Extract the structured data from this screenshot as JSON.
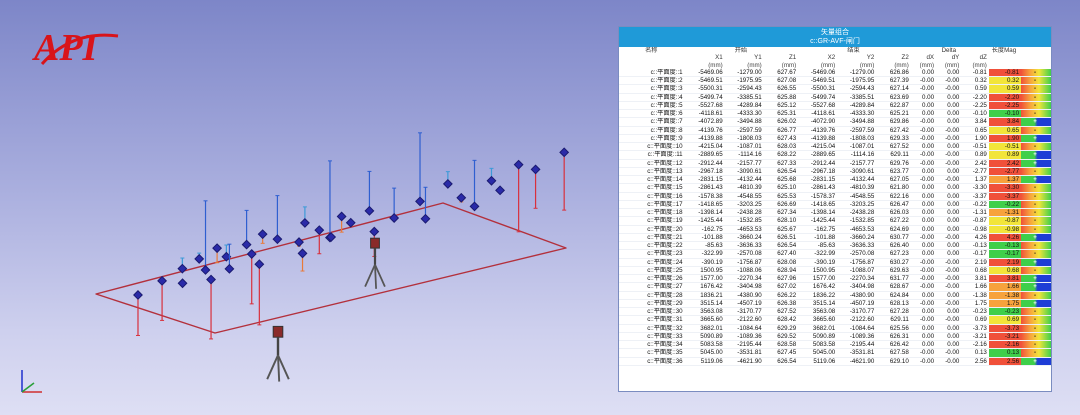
{
  "logo": {
    "text": "API"
  },
  "panel": {
    "title": "矢量组合",
    "subtitle": "c::GR-AVF-闸门",
    "group_headers": {
      "name": "名称",
      "start": "开始",
      "end": "结束",
      "delta": "Delta",
      "mag": "长度Mag"
    },
    "columns": [
      "X1",
      "Y1",
      "Z1",
      "X2",
      "Y2",
      "Z2",
      "dX",
      "dY",
      "dZ"
    ],
    "units": [
      "(mm)",
      "(mm)",
      "(mm)",
      "(mm)",
      "(mm)",
      "(mm)",
      "(mm)",
      "(mm)",
      "(mm)"
    ]
  },
  "colors": {
    "title_bar": "#1f9ad8",
    "red": "#f0503a",
    "orange": "#f7a23c",
    "yellow": "#f2e53a",
    "green": "#3fcf4a",
    "blue": "#1e3dd6",
    "tolerance_bar": [
      "#3fcf4a",
      "#f2e53a",
      "#f7a23c",
      "#f0503a",
      "#1e3dd6"
    ]
  },
  "rows": [
    {
      "name": "c::平面度::1",
      "x1": "-5469.06",
      "y1": "-1279.00",
      "z1": "627.67",
      "x2": "-5469.06",
      "y2": "-1279.00",
      "z2": "626.86",
      "dx": "0.00",
      "dy": "0.00",
      "dz": "-0.81",
      "mag": "-0.81",
      "ind": "-",
      "band": "red"
    },
    {
      "name": "c::平面度::2",
      "x1": "-5469.51",
      "y1": "-1975.95",
      "z1": "627.08",
      "x2": "-5469.51",
      "y2": "-1975.95",
      "z2": "627.39",
      "dx": "-0.00",
      "dy": "-0.00",
      "dz": "0.32",
      "mag": "0.32",
      "ind": "-",
      "band": "yellow"
    },
    {
      "name": "c::平面度::3",
      "x1": "-5500.31",
      "y1": "-2594.43",
      "z1": "626.55",
      "x2": "-5500.31",
      "y2": "-2594.43",
      "z2": "627.14",
      "dx": "-0.00",
      "dy": "-0.00",
      "dz": "0.59",
      "mag": "0.59",
      "ind": "-",
      "band": "yellow"
    },
    {
      "name": "c::平面度::4",
      "x1": "-5499.74",
      "y1": "-3385.51",
      "z1": "625.88",
      "x2": "-5499.74",
      "y2": "-3385.51",
      "z2": "623.69",
      "dx": "0.00",
      "dy": "0.00",
      "dz": "-2.20",
      "mag": "-2.20",
      "ind": "-",
      "band": "red"
    },
    {
      "name": "c::平面度::5",
      "x1": "-5527.68",
      "y1": "-4289.84",
      "z1": "625.12",
      "x2": "-5527.68",
      "y2": "-4289.84",
      "z2": "622.87",
      "dx": "0.00",
      "dy": "0.00",
      "dz": "-2.25",
      "mag": "-2.25",
      "ind": "-",
      "band": "red"
    },
    {
      "name": "c::平面度::6",
      "x1": "-4118.61",
      "y1": "-4333.30",
      "z1": "625.31",
      "x2": "-4118.61",
      "y2": "-4333.30",
      "z2": "625.21",
      "dx": "0.00",
      "dy": "0.00",
      "dz": "-0.10",
      "mag": "-0.10",
      "ind": "-",
      "band": "green"
    },
    {
      "name": "c::平面度::7",
      "x1": "-4072.89",
      "y1": "-3494.88",
      "z1": "626.02",
      "x2": "-4072.90",
      "y2": "-3494.88",
      "z2": "629.86",
      "dx": "-0.00",
      "dy": "0.00",
      "dz": "3.84",
      "mag": "3.84",
      "ind": "+",
      "band": "red"
    },
    {
      "name": "c::平面度::8",
      "x1": "-4139.76",
      "y1": "-2597.59",
      "z1": "626.77",
      "x2": "-4139.76",
      "y2": "-2597.59",
      "z2": "627.42",
      "dx": "-0.00",
      "dy": "-0.00",
      "dz": "0.65",
      "mag": "0.65",
      "ind": "-",
      "band": "yellow"
    },
    {
      "name": "c::平面度::9",
      "x1": "-4139.88",
      "y1": "-1808.03",
      "z1": "627.43",
      "x2": "-4139.88",
      "y2": "-1808.03",
      "z2": "629.33",
      "dx": "-0.00",
      "dy": "-0.00",
      "dz": "1.90",
      "mag": "1.90",
      "ind": "+",
      "band": "red"
    },
    {
      "name": "c::平面度::10",
      "x1": "-4215.04",
      "y1": "-1087.01",
      "z1": "628.03",
      "x2": "-4215.04",
      "y2": "-1087.01",
      "z2": "627.52",
      "dx": "0.00",
      "dy": "0.00",
      "dz": "-0.51",
      "mag": "-0.51",
      "ind": "-",
      "band": "yellow"
    },
    {
      "name": "c::平面度::11",
      "x1": "-2889.65",
      "y1": "-1114.16",
      "z1": "628.22",
      "x2": "-2889.65",
      "y2": "-1114.16",
      "z2": "629.11",
      "dx": "-0.00",
      "dy": "-0.00",
      "dz": "0.89",
      "mag": "0.89",
      "ind": "+",
      "band": "yellow"
    },
    {
      "name": "c::平面度::12",
      "x1": "-2912.44",
      "y1": "-2157.77",
      "z1": "627.33",
      "x2": "-2912.44",
      "y2": "-2157.77",
      "z2": "629.76",
      "dx": "-0.00",
      "dy": "-0.00",
      "dz": "2.42",
      "mag": "2.42",
      "ind": "+",
      "band": "red"
    },
    {
      "name": "c::平面度::13",
      "x1": "-2967.18",
      "y1": "-3090.61",
      "z1": "626.54",
      "x2": "-2967.18",
      "y2": "-3090.61",
      "z2": "623.77",
      "dx": "0.00",
      "dy": "0.00",
      "dz": "-2.77",
      "mag": "-2.77",
      "ind": "-",
      "band": "red"
    },
    {
      "name": "c::平面度::14",
      "x1": "-2831.15",
      "y1": "-4132.44",
      "z1": "625.68",
      "x2": "-2831.15",
      "y2": "-4132.44",
      "z2": "627.05",
      "dx": "-0.00",
      "dy": "-0.00",
      "dz": "1.37",
      "mag": "1.37",
      "ind": "+",
      "band": "orange"
    },
    {
      "name": "c::平面度::15",
      "x1": "-2861.43",
      "y1": "-4810.39",
      "z1": "625.10",
      "x2": "-2861.43",
      "y2": "-4810.39",
      "z2": "621.80",
      "dx": "0.00",
      "dy": "0.00",
      "dz": "-3.30",
      "mag": "-3.30",
      "ind": "-",
      "band": "red"
    },
    {
      "name": "c::平面度::16",
      "x1": "-1578.38",
      "y1": "-4548.55",
      "z1": "625.53",
      "x2": "-1578.37",
      "y2": "-4548.55",
      "z2": "622.16",
      "dx": "0.00",
      "dy": "0.00",
      "dz": "-3.37",
      "mag": "-3.37",
      "ind": "-",
      "band": "red"
    },
    {
      "name": "c::平面度::17",
      "x1": "-1418.65",
      "y1": "-3203.25",
      "z1": "626.69",
      "x2": "-1418.65",
      "y2": "-3203.25",
      "z2": "626.47",
      "dx": "0.00",
      "dy": "0.00",
      "dz": "-0.22",
      "mag": "-0.22",
      "ind": "-",
      "band": "green"
    },
    {
      "name": "c::平面度::18",
      "x1": "-1398.14",
      "y1": "-2438.28",
      "z1": "627.34",
      "x2": "-1398.14",
      "y2": "-2438.28",
      "z2": "626.03",
      "dx": "0.00",
      "dy": "0.00",
      "dz": "-1.31",
      "mag": "-1.31",
      "ind": "-",
      "band": "orange"
    },
    {
      "name": "c::平面度::19",
      "x1": "-1425.44",
      "y1": "-1532.85",
      "z1": "628.10",
      "x2": "-1425.44",
      "y2": "-1532.85",
      "z2": "627.22",
      "dx": "0.00",
      "dy": "0.00",
      "dz": "-0.87",
      "mag": "-0.87",
      "ind": "-",
      "band": "yellow"
    },
    {
      "name": "c::平面度::20",
      "x1": "-162.75",
      "y1": "-4653.53",
      "z1": "625.67",
      "x2": "-162.75",
      "y2": "-4653.53",
      "z2": "624.69",
      "dx": "0.00",
      "dy": "0.00",
      "dz": "-0.98",
      "mag": "-0.98",
      "ind": "-",
      "band": "yellow"
    },
    {
      "name": "c::平面度::21",
      "x1": "-101.88",
      "y1": "-3660.24",
      "z1": "626.51",
      "x2": "-101.88",
      "y2": "-3660.24",
      "z2": "630.77",
      "dx": "-0.00",
      "dy": "-0.00",
      "dz": "4.26",
      "mag": "4.26",
      "ind": "+",
      "band": "red"
    },
    {
      "name": "c::平面度::22",
      "x1": "-85.63",
      "y1": "-3636.33",
      "z1": "626.54",
      "x2": "-85.63",
      "y2": "-3636.33",
      "z2": "626.40",
      "dx": "0.00",
      "dy": "0.00",
      "dz": "-0.13",
      "mag": "-0.13",
      "ind": "-",
      "band": "green"
    },
    {
      "name": "c::平面度::23",
      "x1": "-322.99",
      "y1": "-2570.08",
      "z1": "627.40",
      "x2": "-322.99",
      "y2": "-2570.08",
      "z2": "627.23",
      "dx": "0.00",
      "dy": "0.00",
      "dz": "-0.17",
      "mag": "-0.17",
      "ind": "-",
      "band": "green"
    },
    {
      "name": "c::平面度::24",
      "x1": "-390.19",
      "y1": "-1756.87",
      "z1": "628.08",
      "x2": "-390.19",
      "y2": "-1756.87",
      "z2": "630.27",
      "dx": "-0.00",
      "dy": "-0.00",
      "dz": "2.19",
      "mag": "2.19",
      "ind": "+",
      "band": "red"
    },
    {
      "name": "c::平面度::25",
      "x1": "1500.95",
      "y1": "-1088.06",
      "z1": "628.94",
      "x2": "1500.95",
      "y2": "-1088.07",
      "z2": "629.63",
      "dx": "-0.00",
      "dy": "-0.00",
      "dz": "0.68",
      "mag": "0.68",
      "ind": "-",
      "band": "yellow"
    },
    {
      "name": "c::平面度::26",
      "x1": "1577.00",
      "y1": "-2270.34",
      "z1": "627.96",
      "x2": "1577.00",
      "y2": "-2270.34",
      "z2": "631.77",
      "dx": "-0.00",
      "dy": "-0.00",
      "dz": "3.81",
      "mag": "3.81",
      "ind": "+",
      "band": "red"
    },
    {
      "name": "c::平面度::27",
      "x1": "1676.42",
      "y1": "-3404.98",
      "z1": "627.02",
      "x2": "1676.42",
      "y2": "-3404.98",
      "z2": "628.67",
      "dx": "-0.00",
      "dy": "-0.00",
      "dz": "1.66",
      "mag": "1.66",
      "ind": "+",
      "band": "orange"
    },
    {
      "name": "c::平面度::28",
      "x1": "1836.21",
      "y1": "-4380.90",
      "z1": "626.22",
      "x2": "1836.22",
      "y2": "-4380.90",
      "z2": "624.84",
      "dx": "0.00",
      "dy": "0.00",
      "dz": "-1.38",
      "mag": "-1.38",
      "ind": "-",
      "band": "orange"
    },
    {
      "name": "c::平面度::29",
      "x1": "3515.14",
      "y1": "-4507.19",
      "z1": "626.38",
      "x2": "3515.14",
      "y2": "-4507.19",
      "z2": "628.13",
      "dx": "-0.00",
      "dy": "-0.00",
      "dz": "1.75",
      "mag": "1.75",
      "ind": "+",
      "band": "orange"
    },
    {
      "name": "c::平面度::30",
      "x1": "3563.08",
      "y1": "-3170.77",
      "z1": "627.52",
      "x2": "3563.08",
      "y2": "-3170.77",
      "z2": "627.28",
      "dx": "0.00",
      "dy": "0.00",
      "dz": "-0.23",
      "mag": "-0.23",
      "ind": "-",
      "band": "green"
    },
    {
      "name": "c::平面度::31",
      "x1": "3665.60",
      "y1": "-2122.60",
      "z1": "628.42",
      "x2": "3665.60",
      "y2": "-2122.60",
      "z2": "629.11",
      "dx": "-0.00",
      "dy": "-0.00",
      "dz": "0.69",
      "mag": "0.69",
      "ind": "-",
      "band": "yellow"
    },
    {
      "name": "c::平面度::32",
      "x1": "3682.01",
      "y1": "-1084.64",
      "z1": "629.29",
      "x2": "3682.01",
      "y2": "-1084.64",
      "z2": "625.56",
      "dx": "0.00",
      "dy": "0.00",
      "dz": "-3.73",
      "mag": "-3.73",
      "ind": "-",
      "band": "red"
    },
    {
      "name": "c::平面度::33",
      "x1": "5090.89",
      "y1": "-1089.36",
      "z1": "629.52",
      "x2": "5090.89",
      "y2": "-1089.36",
      "z2": "626.31",
      "dx": "0.00",
      "dy": "0.00",
      "dz": "-3.21",
      "mag": "-3.21",
      "ind": "-",
      "band": "red"
    },
    {
      "name": "c::平面度::34",
      "x1": "5083.58",
      "y1": "-2195.44",
      "z1": "628.58",
      "x2": "5083.58",
      "y2": "-2195.44",
      "z2": "626.42",
      "dx": "0.00",
      "dy": "0.00",
      "dz": "-2.16",
      "mag": "-2.16",
      "ind": "-",
      "band": "red"
    },
    {
      "name": "c::平面度::35",
      "x1": "5045.00",
      "y1": "-3531.81",
      "z1": "627.45",
      "x2": "5045.00",
      "y2": "-3531.81",
      "z2": "627.58",
      "dx": "-0.00",
      "dy": "-0.00",
      "dz": "0.13",
      "mag": "0.13",
      "ind": "-",
      "band": "green"
    },
    {
      "name": "c::平面度::36",
      "x1": "5119.06",
      "y1": "-4621.90",
      "z1": "626.54",
      "x2": "5119.06",
      "y2": "-4621.90",
      "z2": "629.10",
      "dx": "-0.00",
      "dy": "-0.00",
      "dz": "2.56",
      "mag": "2.56",
      "ind": "+",
      "band": "red"
    }
  ],
  "viewport": {
    "icons": [
      "laser-tracker-icon",
      "axis-triad-icon"
    ]
  }
}
